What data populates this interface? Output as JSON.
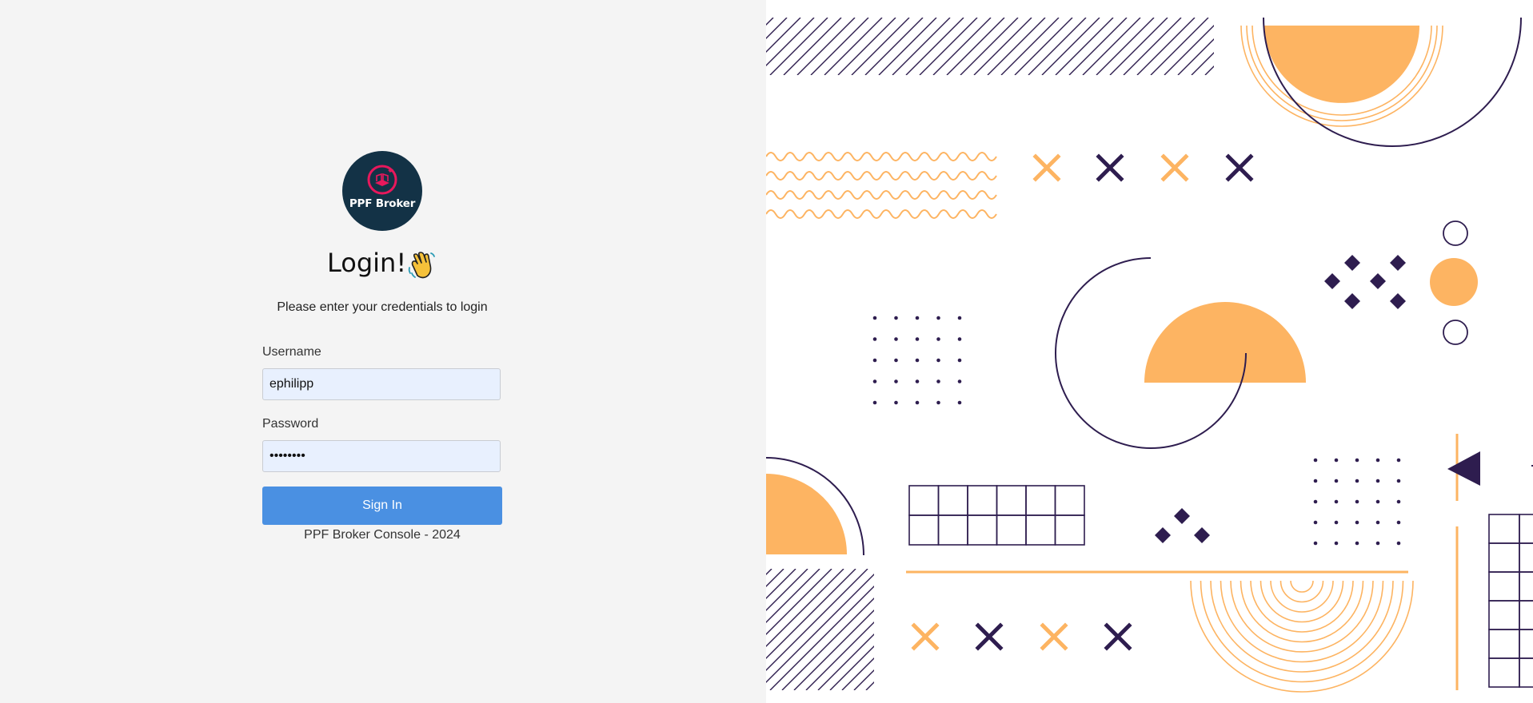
{
  "login": {
    "brand_name": "PPF Broker",
    "title": "Login!",
    "greeting_icon": "waving-hand-icon",
    "subtitle": "Please enter your credentials to login",
    "username_label": "Username",
    "username_value": "ephilipp",
    "password_label": "Password",
    "password_value": "password",
    "sign_in_label": "Sign In",
    "footer": "PPF Broker Console - 2024"
  },
  "colors": {
    "logo_bg": "#133246",
    "logo_accent": "#e8185c",
    "button": "#4a90e2",
    "input_bg": "#e8f0fe",
    "decor_orange": "#fdb462",
    "decor_navy": "#2e1d4f"
  }
}
